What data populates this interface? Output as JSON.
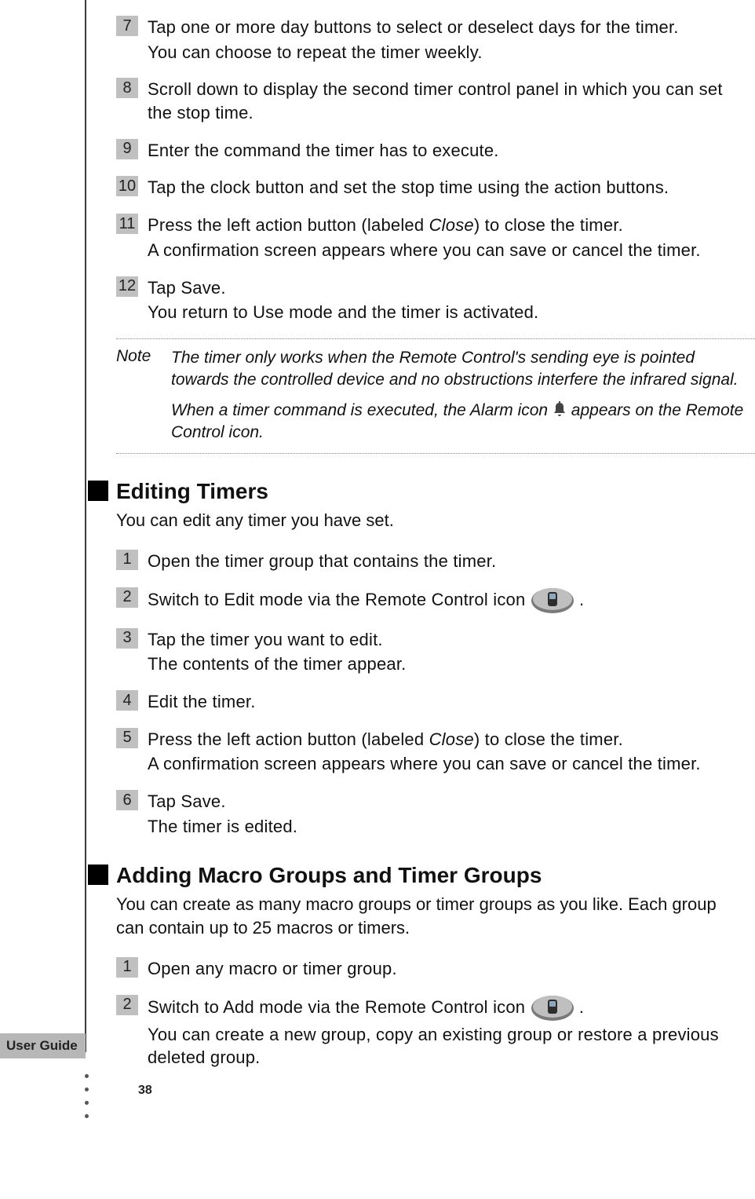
{
  "steps_a": [
    {
      "num": "7",
      "main": "Tap one or more day buttons to select or deselect days for the timer.",
      "sub": "You can choose to repeat the timer weekly."
    },
    {
      "num": "8",
      "main": "Scroll down to display the second timer control panel in which you can set the stop time.",
      "sub": ""
    },
    {
      "num": "9",
      "main": "Enter the command the timer has to execute.",
      "sub": ""
    },
    {
      "num": "10",
      "main": "Tap the clock button and set the stop time using the action buttons.",
      "sub": ""
    },
    {
      "num": "11",
      "main_prefix": "Press the left action button (labeled ",
      "main_italic": "Close",
      "main_suffix": ") to close the timer.",
      "sub": "A confirmation screen appears where you can save or cancel the timer."
    },
    {
      "num": "12",
      "main": "Tap Save.",
      "sub": "You return to Use mode and the timer is activated."
    }
  ],
  "note": {
    "label": "Note",
    "para1": "The timer only works when the Remote Control's sending eye is pointed towards the controlled device and no obstructions interfere the infrared signal.",
    "para2_prefix": "When a timer command is executed, the Alarm icon ",
    "para2_suffix": " appears on the Remote Control icon."
  },
  "section_b": {
    "title": "Editing Timers",
    "intro": "You can edit any timer you have set.",
    "steps": [
      {
        "num": "1",
        "main": "Open the timer group that contains the timer.",
        "sub": ""
      },
      {
        "num": "2",
        "main_prefix": "Switch to Edit mode via the Remote Control icon ",
        "main_suffix": ".",
        "has_remote_icon": true,
        "sub": ""
      },
      {
        "num": "3",
        "main": "Tap the timer you want to edit.",
        "sub": "The contents of the timer appear."
      },
      {
        "num": "4",
        "main": "Edit the timer.",
        "sub": ""
      },
      {
        "num": "5",
        "main_prefix": "Press the left action button (labeled ",
        "main_italic": "Close",
        "main_suffix": ") to close the timer.",
        "sub": "A confirmation screen appears where you can save or cancel the timer."
      },
      {
        "num": "6",
        "main": "Tap Save.",
        "sub": "The timer is edited."
      }
    ]
  },
  "section_c": {
    "title": "Adding Macro Groups and Timer Groups",
    "intro": "You can create as many macro groups or timer groups as you like. Each group can contain up to 25 macros or timers.",
    "steps": [
      {
        "num": "1",
        "main": "Open any macro or timer group.",
        "sub": ""
      },
      {
        "num": "2",
        "main_prefix": "Switch to Add mode via the Remote Control icon ",
        "main_suffix": ".",
        "has_remote_icon": true,
        "sub": "You can create a new group, copy an existing group or restore a previous deleted group."
      }
    ]
  },
  "footer": {
    "label": "User Guide",
    "page": "38"
  }
}
